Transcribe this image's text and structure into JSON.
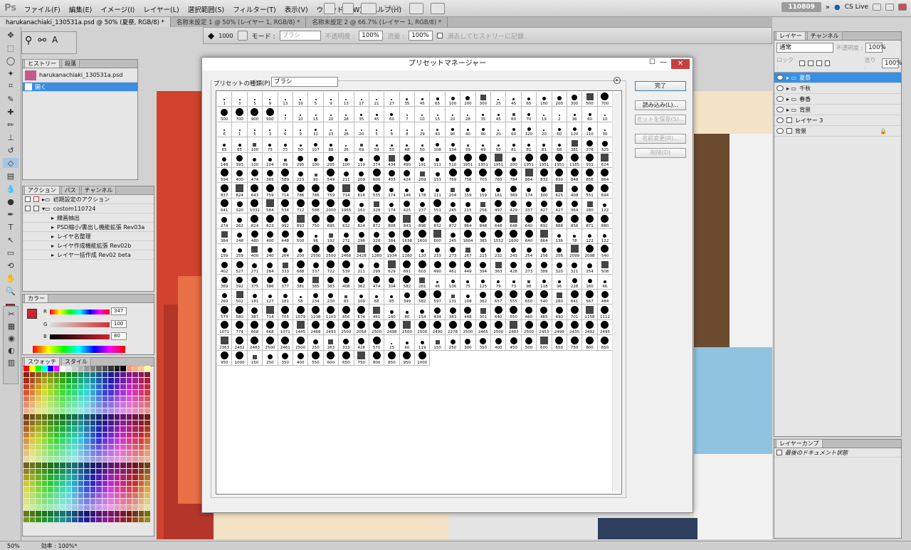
{
  "app": {
    "logo": "Ps",
    "counter": "110809",
    "cslive": "CS Live"
  },
  "menu": [
    "ファイル(F)",
    "編集(E)",
    "イメージ(I)",
    "レイヤー(L)",
    "選択範囲(S)",
    "フィルター(T)",
    "表示(V)",
    "ウィンドウ(W)",
    "ヘルプ(H)"
  ],
  "menuzoom": "100%",
  "tabs": [
    "harukanachiaki_130531a.psd @ 50% (夏祭, RGB/8) *",
    "名称未設定 1 @ 50% (レイヤー 1, RGB/8) *",
    "名称未設定 2 @ 66.7% (レイヤー 1, RGB/8) *"
  ],
  "options": {
    "size": "1000",
    "mode_label": "モード :",
    "mode_value": "ブラシ",
    "opacity_label": "不透明度 :",
    "opacity": "100%",
    "flow_label": "流量 :",
    "flow": "100%",
    "history_label": "消去してヒストリーに記録"
  },
  "history": {
    "tabs": [
      "ヒストリー",
      "段落"
    ],
    "doc": "harukanachiaki_130531a.psd",
    "step": "開く"
  },
  "actions": {
    "tabs": [
      "アクション",
      "パス",
      "チャンネル"
    ],
    "rows": [
      "初期設定のアクション",
      "costom110724",
      "線画抽出",
      "PSD縮小/書出し機能拡張 Rev03a",
      "レイヤ名整理",
      "レイヤ作成機能拡張 Rev02b",
      "レイヤ一括作成 Rev02 beta"
    ]
  },
  "color": {
    "tab": "カラー",
    "r": "R",
    "g": "G",
    "b": "B",
    "rv": "347",
    "gv": "100",
    "bv": "80"
  },
  "swatches": {
    "tabs": [
      "スウォッチ",
      "スタイル"
    ]
  },
  "layers": {
    "tabs": [
      "レイヤー",
      "チャンネル"
    ],
    "blend": "通常",
    "opacity_label": "不透明度 :",
    "opacity": "100%",
    "lock_label": "ロック :",
    "fill_label": "塗り :",
    "fill": "100%",
    "rows": [
      "夏祭",
      "千秋",
      "春香",
      "背景",
      "レイヤー 3",
      "背景"
    ]
  },
  "layercomp": {
    "tab": "レイヤーカンプ",
    "row": "最後のドキュメント状態"
  },
  "dialog": {
    "title": "プリセットマネージャー",
    "type_label": "プリセットの種類(P) :",
    "type_value": "ブラシ",
    "buttons": [
      "完了",
      "読み込み(L)...",
      "セットを保存(S)...",
      "名前変更(R)...",
      "削除(D)"
    ]
  },
  "brushes": [
    "1",
    "3",
    "5",
    "9",
    "13",
    "19",
    "5",
    "9",
    "13",
    "17",
    "21",
    "27",
    "35",
    "45",
    "65",
    "100",
    "200",
    "300",
    "25",
    "45",
    "65",
    "100",
    "200",
    "300",
    "500",
    "700",
    "500",
    "700",
    "900",
    "900",
    "7",
    "10",
    "15",
    "20",
    "28",
    "35",
    "45",
    "60",
    "7",
    "10",
    "15",
    "20",
    "28",
    "35",
    "45",
    "60",
    "70",
    "19",
    "2",
    "36",
    "60",
    "10",
    "6",
    "1",
    "5",
    "3",
    "6",
    "9",
    "32",
    "13",
    "28",
    "20",
    "5",
    "6",
    "8",
    "29",
    "40",
    "90",
    "40",
    "90",
    "20",
    "60",
    "120",
    "20",
    "60",
    "120",
    "110",
    "30",
    "65",
    "65",
    "100",
    "75",
    "75",
    "50",
    "107",
    "88",
    "26",
    "69",
    "59",
    "50",
    "48",
    "50",
    "108",
    "134",
    "59",
    "49",
    "50",
    "81",
    "81",
    "81",
    "68",
    "381",
    "376",
    "325",
    "148",
    "393",
    "100",
    "104",
    "89",
    "295",
    "100",
    "295",
    "100",
    "119",
    "374",
    "434",
    "490",
    "191",
    "111",
    "510",
    "1951",
    "1951",
    "1951",
    "200",
    "1951",
    "1951",
    "1951",
    "1185",
    "931",
    "624",
    "594",
    "400",
    "474",
    "365",
    "589",
    "223",
    "90",
    "549",
    "211",
    "209",
    "600",
    "403",
    "424",
    "269",
    "153",
    "769",
    "756",
    "703",
    "760",
    "784",
    "864",
    "832",
    "830",
    "848",
    "856",
    "864",
    "837",
    "824",
    "643",
    "759",
    "714",
    "786",
    "786",
    "759",
    "714",
    "816",
    "535",
    "174",
    "146",
    "178",
    "111",
    "204",
    "159",
    "159",
    "161",
    "389",
    "174",
    "300",
    "625",
    "408",
    "551",
    "694",
    "641",
    "320",
    "1032",
    "584",
    "534",
    "712",
    "588",
    "2000",
    "1965",
    "161",
    "328",
    "174",
    "425",
    "237",
    "551",
    "245",
    "215",
    "256",
    "497",
    "429",
    "337",
    "427",
    "427",
    "364",
    "280",
    "122",
    "274",
    "262",
    "824",
    "823",
    "992",
    "893",
    "750",
    "695",
    "632",
    "824",
    "872",
    "808",
    "843",
    "896",
    "832",
    "872",
    "864",
    "848",
    "648",
    "648",
    "640",
    "892",
    "888",
    "856",
    "871",
    "880",
    "384",
    "248",
    "480",
    "400",
    "448",
    "500",
    "96",
    "192",
    "272",
    "296",
    "328",
    "384",
    "1638",
    "1600",
    "600",
    "245",
    "1664",
    "385",
    "1552",
    "1600",
    "640",
    "864",
    "136",
    "78",
    "122",
    "122",
    "159",
    "159",
    "400",
    "240",
    "264",
    "200",
    "2500",
    "2500",
    "2468",
    "2428",
    "1280",
    "1934",
    "1280",
    "120",
    "233",
    "273",
    "267",
    "215",
    "232",
    "243",
    "254",
    "256",
    "256",
    "2099",
    "2098",
    "540",
    "402",
    "527",
    "271",
    "284",
    "333",
    "688",
    "337",
    "722",
    "539",
    "211",
    "299",
    "629",
    "691",
    "603",
    "490",
    "461",
    "449",
    "394",
    "363",
    "428",
    "273",
    "389",
    "320",
    "321",
    "254",
    "508",
    "369",
    "392",
    "375",
    "386",
    "377",
    "381",
    "385",
    "383",
    "408",
    "362",
    "474",
    "304",
    "582",
    "281",
    "46",
    "106",
    "75",
    "125",
    "79",
    "73",
    "98",
    "118",
    "96",
    "228",
    "160",
    "66",
    "269",
    "502",
    "181",
    "127",
    "181",
    "58",
    "234",
    "230",
    "83",
    "109",
    "68",
    "85",
    "349",
    "582",
    "597",
    "131",
    "108",
    "362",
    "657",
    "555",
    "650",
    "540",
    "280",
    "641",
    "567",
    "484",
    "573",
    "580",
    "387",
    "714",
    "705",
    "1079",
    "1238",
    "1103",
    "856",
    "674",
    "461",
    "140",
    "80",
    "154",
    "434",
    "383",
    "448",
    "301",
    "640",
    "550",
    "460",
    "465",
    "490",
    "701",
    "1158",
    "1112",
    "1071",
    "774",
    "668",
    "668",
    "1071",
    "1445",
    "2468",
    "2493",
    "2500",
    "2058",
    "2500",
    "2498",
    "2500",
    "2500",
    "2490",
    "2278",
    "2500",
    "2465",
    "2500",
    "2483",
    "2500",
    "2453",
    "2499",
    "2435",
    "2492",
    "2495",
    "2363",
    "2402",
    "2483",
    "2500",
    "2461",
    "2500",
    "250",
    "263",
    "333",
    "428",
    "571",
    "25",
    "60",
    "119",
    "150",
    "250",
    "300",
    "350",
    "400",
    "450",
    "500",
    "600",
    "650",
    "750",
    "800",
    "850",
    "950",
    "1000",
    "150",
    "250",
    "350",
    "400",
    "550",
    "600",
    "650",
    "750",
    "800",
    "850",
    "950",
    "1000"
  ],
  "status": {
    "zoom": "50%",
    "eff_label": "効率 : 100%*"
  }
}
